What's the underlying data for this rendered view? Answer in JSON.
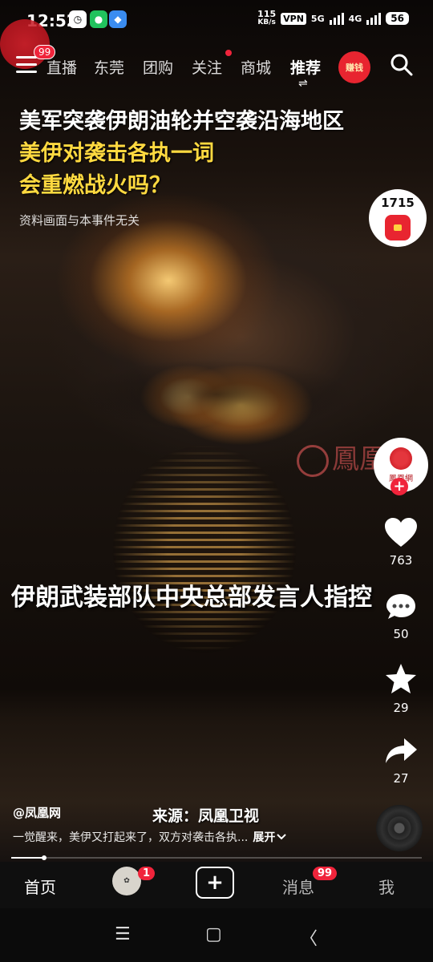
{
  "status_bar": {
    "time": "12:52",
    "network_speed_value": "115",
    "network_speed_unit": "KB/s",
    "vpn": "VPN",
    "signal_1": "5G",
    "signal_2": "4G",
    "battery": "56"
  },
  "top_nav": {
    "menu_badge": "99",
    "tabs": [
      "直播",
      "东莞",
      "团购",
      "关注",
      "商城",
      "推荐"
    ],
    "active_tab": "推荐",
    "swap_glyph": "⇌",
    "earn_label": "赚钱"
  },
  "video": {
    "headline_line1": "美军突袭伊朗油轮并空袭沿海地区",
    "headline_line2": "美伊对袭击各执一词",
    "headline_line3": "会重燃战火吗？",
    "disclaimer": "资料画面与本事件无关",
    "watermark": "鳳凰網",
    "subtitle": "伊朗武装部队中央总部发言人指控"
  },
  "right_rail": {
    "coin_count": "1715",
    "creator_avatar_label": "鳳凰網",
    "follow_glyph": "+",
    "likes": "763",
    "comments": "50",
    "favorites": "29",
    "shares": "27"
  },
  "info": {
    "author": "@凤凰网",
    "source": "来源：凤凰卫视",
    "description": "一觉醒来，美伊又打起来了，双方对袭击各执...",
    "expand_label": "展开"
  },
  "playback": {
    "progress_fraction": 0.08
  },
  "bottom_nav": {
    "home": "首页",
    "friends_badge": "1",
    "create_glyph": "+",
    "messages": "消息",
    "messages_badge": "99",
    "me": "我"
  },
  "system_nav": {
    "recents": "☰",
    "home": "▢",
    "back": "〈"
  },
  "colors": {
    "accent_red": "#f0243b",
    "headline_yellow": "#ffd940"
  }
}
